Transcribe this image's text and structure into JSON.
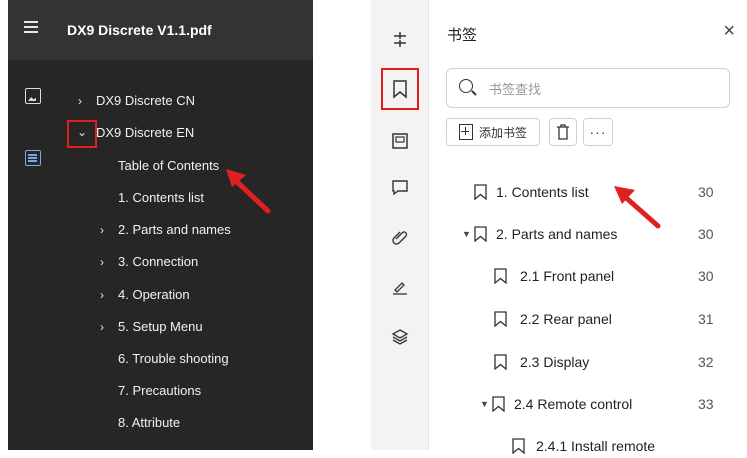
{
  "left_panel": {
    "title": "DX9 Discrete V1.1.pdf",
    "icons": [
      "menu-icon",
      "image-icon",
      "toc-icon"
    ],
    "tree": [
      {
        "label": "DX9 Discrete CN",
        "expanded": false
      },
      {
        "label": "DX9 Discrete EN",
        "expanded": true
      },
      {
        "label": "Table of Contents"
      },
      {
        "label": "1. Contents list"
      },
      {
        "label": "2. Parts and names",
        "expandable": true
      },
      {
        "label": "3. Connection",
        "expandable": true
      },
      {
        "label": "4. Operation",
        "expandable": true
      },
      {
        "label": "5. Setup Menu",
        "expandable": true
      },
      {
        "label": "6. Trouble shooting"
      },
      {
        "label": "7. Precautions"
      },
      {
        "label": "8. Attribute"
      }
    ]
  },
  "right_panel": {
    "title": "书签",
    "close": "×",
    "search_placeholder": "书签查找",
    "add_label": "添加书签",
    "more": "···",
    "tools": [
      "tune-icon",
      "bookmark-icon",
      "thumbnail-icon",
      "comment-icon",
      "attachment-icon",
      "signature-icon",
      "layers-icon"
    ],
    "bookmarks": [
      {
        "label": "1. Contents list",
        "page": "30"
      },
      {
        "label": "2. Parts and names",
        "page": "30",
        "expanded": true
      },
      {
        "label": "2.1 Front panel",
        "page": "30"
      },
      {
        "label": "2.2 Rear panel",
        "page": "31"
      },
      {
        "label": "2.3 Display",
        "page": "32"
      },
      {
        "label": "2.4 Remote control",
        "page": "33",
        "expanded": true
      },
      {
        "label": "2.4.1 Install remote"
      }
    ]
  },
  "colors": {
    "highlight": "#e02020",
    "dark_bg": "#262626",
    "accent": "#7aa7e8"
  }
}
